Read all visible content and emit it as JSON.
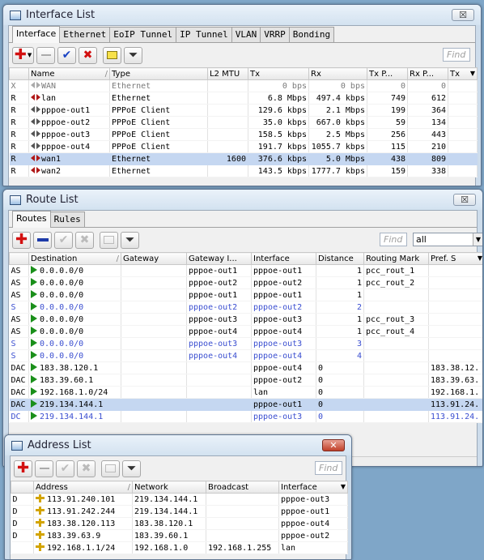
{
  "colors": {
    "accent": "#c5d7f1",
    "add": "#d21010",
    "route_green": "#1a8f1a",
    "dynamic_blue": "#3a4ed0"
  },
  "interface_window": {
    "title": "Interface List",
    "close_label": "☒",
    "tabs": [
      "Interface",
      "Ethernet",
      "EoIP Tunnel",
      "IP Tunnel",
      "VLAN",
      "VRRP",
      "Bonding"
    ],
    "find_placeholder": "Find",
    "columns": [
      "",
      "Name",
      "Type",
      "L2 MTU",
      "Tx",
      "Rx",
      "Tx P...",
      "Rx P...",
      "Tx"
    ],
    "rows": [
      {
        "flag": "X",
        "name": "WAN",
        "type": "Ethernet",
        "mtu": "",
        "tx": "0 bps",
        "rx": "0 bps",
        "txp": "0",
        "rxp": "0",
        "icon": "interface-disabled-icon"
      },
      {
        "flag": "R",
        "name": "lan",
        "type": "Ethernet",
        "mtu": "",
        "tx": "6.8 Mbps",
        "rx": "497.4 kbps",
        "txp": "749",
        "rxp": "612",
        "icon": "interface-ethernet-icon"
      },
      {
        "flag": "R",
        "name": "pppoe-out1",
        "type": "PPPoE Client",
        "mtu": "",
        "tx": "129.6 kbps",
        "rx": "2.1 Mbps",
        "txp": "199",
        "rxp": "364",
        "icon": "interface-pppoe-icon"
      },
      {
        "flag": "R",
        "name": "pppoe-out2",
        "type": "PPPoE Client",
        "mtu": "",
        "tx": "35.0 kbps",
        "rx": "667.0 kbps",
        "txp": "59",
        "rxp": "134",
        "icon": "interface-pppoe-icon"
      },
      {
        "flag": "R",
        "name": "pppoe-out3",
        "type": "PPPoE Client",
        "mtu": "",
        "tx": "158.5 kbps",
        "rx": "2.5 Mbps",
        "txp": "256",
        "rxp": "443",
        "icon": "interface-pppoe-icon"
      },
      {
        "flag": "R",
        "name": "pppoe-out4",
        "type": "PPPoE Client",
        "mtu": "",
        "tx": "191.7 kbps",
        "rx": "1055.7 kbps",
        "txp": "115",
        "rxp": "210",
        "icon": "interface-pppoe-icon"
      },
      {
        "flag": "R",
        "name": "wan1",
        "type": "Ethernet",
        "mtu": "1600",
        "tx": "376.6 kbps",
        "rx": "5.0 Mbps",
        "txp": "438",
        "rxp": "809",
        "icon": "interface-ethernet-icon",
        "selected": true
      },
      {
        "flag": "R",
        "name": "wan2",
        "type": "Ethernet",
        "mtu": "",
        "tx": "143.5 kbps",
        "rx": "1777.7 kbps",
        "txp": "159",
        "rxp": "338",
        "icon": "interface-ethernet-icon"
      }
    ]
  },
  "route_window": {
    "title": "Route List",
    "close_label": "☒",
    "tabs": [
      "Routes",
      "Rules"
    ],
    "find_placeholder": "Find",
    "filter_value": "all",
    "columns": [
      "",
      "Destination",
      "Gateway",
      "Gateway I...",
      "Interface",
      "Distance",
      "Routing Mark",
      "Pref. S"
    ],
    "rows": [
      {
        "flag": "AS",
        "dst": "0.0.0.0/0",
        "gw": "",
        "gwi": "pppoe-out1",
        "iface": "pppoe-out1",
        "dist": "1",
        "mark": "pcc_rout_1",
        "pref": "",
        "style": ""
      },
      {
        "flag": "AS",
        "dst": "0.0.0.0/0",
        "gw": "",
        "gwi": "pppoe-out2",
        "iface": "pppoe-out2",
        "dist": "1",
        "mark": "pcc_rout_2",
        "pref": "",
        "style": ""
      },
      {
        "flag": "AS",
        "dst": "0.0.0.0/0",
        "gw": "",
        "gwi": "pppoe-out1",
        "iface": "pppoe-out1",
        "dist": "1",
        "mark": "",
        "pref": "",
        "style": ""
      },
      {
        "flag": "S",
        "dst": "0.0.0.0/0",
        "gw": "",
        "gwi": "pppoe-out2",
        "iface": "pppoe-out2",
        "dist": "2",
        "mark": "",
        "pref": "",
        "style": "blue"
      },
      {
        "flag": "AS",
        "dst": "0.0.0.0/0",
        "gw": "",
        "gwi": "pppoe-out3",
        "iface": "pppoe-out3",
        "dist": "1",
        "mark": "pcc_rout_3",
        "pref": "",
        "style": ""
      },
      {
        "flag": "AS",
        "dst": "0.0.0.0/0",
        "gw": "",
        "gwi": "pppoe-out4",
        "iface": "pppoe-out4",
        "dist": "1",
        "mark": "pcc_rout_4",
        "pref": "",
        "style": ""
      },
      {
        "flag": "S",
        "dst": "0.0.0.0/0",
        "gw": "",
        "gwi": "pppoe-out3",
        "iface": "pppoe-out3",
        "dist": "3",
        "mark": "",
        "pref": "",
        "style": "blue"
      },
      {
        "flag": "S",
        "dst": "0.0.0.0/0",
        "gw": "",
        "gwi": "pppoe-out4",
        "iface": "pppoe-out4",
        "dist": "4",
        "mark": "",
        "pref": "",
        "style": "blue"
      },
      {
        "flag": "DAC",
        "dst": "183.38.120.1",
        "gw": "",
        "gwi": "",
        "iface": "pppoe-out4",
        "dist": "0",
        "mark": "",
        "pref": "183.38.12.",
        "style": ""
      },
      {
        "flag": "DAC",
        "dst": "183.39.60.1",
        "gw": "",
        "gwi": "",
        "iface": "pppoe-out2",
        "dist": "0",
        "mark": "",
        "pref": "183.39.63.",
        "style": ""
      },
      {
        "flag": "DAC",
        "dst": "192.168.1.0/24",
        "gw": "",
        "gwi": "",
        "iface": "lan",
        "dist": "0",
        "mark": "",
        "pref": "192.168.1.",
        "style": ""
      },
      {
        "flag": "DAC",
        "dst": "219.134.144.1",
        "gw": "",
        "gwi": "",
        "iface": "pppoe-out1",
        "dist": "0",
        "mark": "",
        "pref": "113.91.24.",
        "style": "hl"
      },
      {
        "flag": "DC",
        "dst": "219.134.144.1",
        "gw": "",
        "gwi": "",
        "iface": "pppoe-out3",
        "dist": "0",
        "mark": "",
        "pref": "113.91.24.",
        "style": "blue"
      }
    ]
  },
  "address_window": {
    "title": "Address List",
    "close_label": "✕",
    "find_placeholder": "Find",
    "columns": [
      "",
      "Address",
      "Network",
      "Broadcast",
      "Interface"
    ],
    "rows": [
      {
        "flag": "D",
        "addr": "113.91.240.101",
        "net": "219.134.144.1",
        "bc": "",
        "iface": "pppoe-out3"
      },
      {
        "flag": "D",
        "addr": "113.91.242.244",
        "net": "219.134.144.1",
        "bc": "",
        "iface": "pppoe-out1"
      },
      {
        "flag": "D",
        "addr": "183.38.120.113",
        "net": "183.38.120.1",
        "bc": "",
        "iface": "pppoe-out4"
      },
      {
        "flag": "D",
        "addr": "183.39.63.9",
        "net": "183.39.60.1",
        "bc": "",
        "iface": "pppoe-out2"
      },
      {
        "flag": "",
        "addr": "192.168.1.1/24",
        "net": "192.168.1.0",
        "bc": "192.168.1.255",
        "iface": "lan"
      }
    ]
  }
}
